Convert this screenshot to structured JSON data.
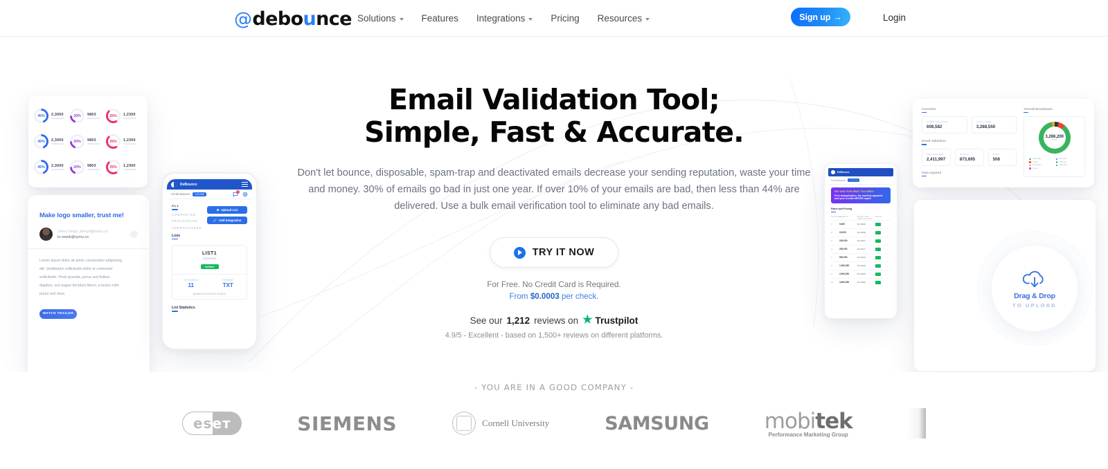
{
  "header": {
    "logo": {
      "at": "@",
      "part1": "debo",
      "part2": "u",
      "part3": "nce"
    },
    "nav": [
      {
        "label": "Solutions",
        "caret": true
      },
      {
        "label": "Features",
        "caret": false
      },
      {
        "label": "Integrations",
        "caret": true
      },
      {
        "label": "Pricing",
        "caret": false
      },
      {
        "label": "Resources",
        "caret": true
      }
    ],
    "login_label": "Login",
    "signup_label": "Sign up",
    "signup_arrow": "→"
  },
  "hero": {
    "headline_line1": "Email Validation Tool;",
    "headline_line2": "Simple, Fast & Accurate.",
    "subhead": "Don't let bounce, disposable, spam-trap and deactivated emails decrease your sending reputation, waste your time and money. 30% of emails go bad in just one year. If over 10% of your emails are bad, then less than 44% are delivered. Use a bulk email verification tool to eliminate any bad emails.",
    "cta_label": "TRY IT NOW",
    "free_note": "For Free. No Credit Card is Required.",
    "price_prefix": "From ",
    "price_value": "$0.0003",
    "price_suffix": " per check.",
    "trust_prefix": "See our ",
    "trust_count": "1,212",
    "trust_mid": " reviews on ",
    "trustpilot": "Trustpilot",
    "trust_sub": "4.9/5 - Excellent - based on 1,500+ reviews on different platforms."
  },
  "stats_card": {
    "cells": [
      {
        "pct": "45%",
        "value": "2,3000",
        "color": "#2e6bf0"
      },
      {
        "pct": "20%",
        "value": "9803",
        "color": "#8e3bd4"
      },
      {
        "pct": "25%",
        "value": "1,2300",
        "color": "#ea2f68"
      },
      {
        "pct": "45%",
        "value": "2,3000",
        "color": "#2e6bf0"
      },
      {
        "pct": "20%",
        "value": "9803",
        "color": "#8e3bd4"
      },
      {
        "pct": "25%",
        "value": "1,2300",
        "color": "#ea2f68"
      },
      {
        "pct": "45%",
        "value": "2,3000",
        "color": "#2e6bf0"
      },
      {
        "pct": "20%",
        "value": "9803",
        "color": "#8e3bd4"
      },
      {
        "pct": "25%",
        "value": "1,2300",
        "color": "#ea2f68"
      }
    ]
  },
  "email_card": {
    "title": "Make logo smaller, trust me!",
    "from": "Johny Depp, johnyd@symu.co",
    "to": "to wasik@symu.co",
    "body_lines": [
      "Lorem ipsum dolor sit amet, consectetur adipiscing",
      "elit. Vestibulum sollicitudin dolor ut commodo",
      "sollicitudin. Proin gravida, purus sed finibus",
      "dapibus, orci augue tincidunt libero, a luctus nibh",
      "purus sed risus."
    ],
    "button": "WATCH TRAILER"
  },
  "phone": {
    "brand": "DeBounce",
    "balance_label": "Credit Balance",
    "balance_pill": "120,042",
    "tabs": [
      "ALL",
      "COMPLETED",
      "PROCESSING",
      "UNPROCESSED"
    ],
    "btn_upload": "Upload List",
    "btn_integration": "Add Integration",
    "section_lists": "Lists",
    "list_name": "LIST1",
    "list_date": "01/28/2019",
    "verified_badge": "verified",
    "records_label": "RECORDS",
    "records_value": "11",
    "format_label": "FORMAT",
    "format_value": "TXT",
    "finished": "finished at 01/01/1970 03:30:00",
    "section_stats": "List Statistics"
  },
  "tablet": {
    "brand": "DeBounce",
    "balance_label": "Credit Balance",
    "balance_pill": "120,042",
    "banner_top": "PAY ONLY FOR WHAT YOU NEED!",
    "banner_body": "Free deduplication, No monthly payment and your credits NEVER expire",
    "section": "Plans and Pricing",
    "columns": [
      "PACKAGE",
      "CREDITS",
      "PRICE PER VERIFICATION",
      "PRICE"
    ],
    "rows": [
      {
        "n": "1",
        "credits": "5,000",
        "unit": "verifications",
        "price": "$ 0.0040",
        "per": "verification"
      },
      {
        "n": "2",
        "credits": "10,000",
        "unit": "verifications",
        "price": "$ 0.0038",
        "per": "verification"
      },
      {
        "n": "3",
        "credits": "100,000",
        "unit": "verifications",
        "price": "$ 0.0027",
        "per": "verification"
      },
      {
        "n": "4",
        "credits": "200,000",
        "unit": "verifications",
        "price": "$ 0.0017",
        "per": "verification"
      },
      {
        "n": "7",
        "credits": "500,000",
        "unit": "verifications",
        "price": "$ 0.0013",
        "per": "verification"
      },
      {
        "n": "8",
        "credits": "1,000,000",
        "unit": "verifications",
        "price": "$ 0.0010",
        "per": "verification"
      },
      {
        "n": "9",
        "credits": "2,000,000",
        "unit": "verifications",
        "price": "$ 0.0006",
        "per": "verification"
      },
      {
        "n": "10",
        "credits": "4,000,000",
        "unit": "verifications",
        "price": "$ 0.0005",
        "per": "verification"
      }
    ]
  },
  "dashboard": {
    "overview_label": "Overview",
    "overview_boxes": [
      {
        "label": "CREDIT BALANCE",
        "value": "608,582"
      },
      {
        "label": "TOTAL USED",
        "value": "3,288,550"
      }
    ],
    "validation_label": "Email Validation",
    "validation_boxes": [
      {
        "label": "DELIVERABLE",
        "value": "2,411,997"
      },
      {
        "label": "INVALID",
        "value": "873,695"
      },
      {
        "label": "RISKY",
        "value": "508"
      }
    ],
    "append_label": "Data Append",
    "breakdown_label": "Overall Breakdown",
    "donut_value": "3,286,200",
    "donut_sub": "TOTAL",
    "legend": [
      {
        "label": "Deliverable",
        "color": "#3ab45c"
      },
      {
        "label": "Accept-all",
        "color": "#2e7df0"
      },
      {
        "label": "Invalid",
        "color": "#e8452f"
      },
      {
        "label": "Unknown",
        "color": "#3ab45c"
      },
      {
        "label": "Disposable",
        "color": "#f0a623"
      },
      {
        "label": "Spam-trap",
        "color": "#2e7df0"
      },
      {
        "label": "Syntax",
        "color": "#c64ad6"
      }
    ]
  },
  "dropzone": {
    "title": "Drag & Drop",
    "subtitle": "TO UPLOAD",
    "icon": "cloud-upload-icon"
  },
  "companies": {
    "title": "- YOU ARE IN A GOOD COMPANY -",
    "logos": [
      {
        "name": "eset",
        "a": "es",
        "b": "eт"
      },
      {
        "name": "siemens",
        "text": "SIEMENS"
      },
      {
        "name": "cornell",
        "text": "Cornell University"
      },
      {
        "name": "samsung",
        "text": "SAMSUNG"
      },
      {
        "name": "mobitek",
        "m1": "mobi",
        "m2": "tek",
        "sub": "Performance Marketing Group"
      }
    ]
  }
}
